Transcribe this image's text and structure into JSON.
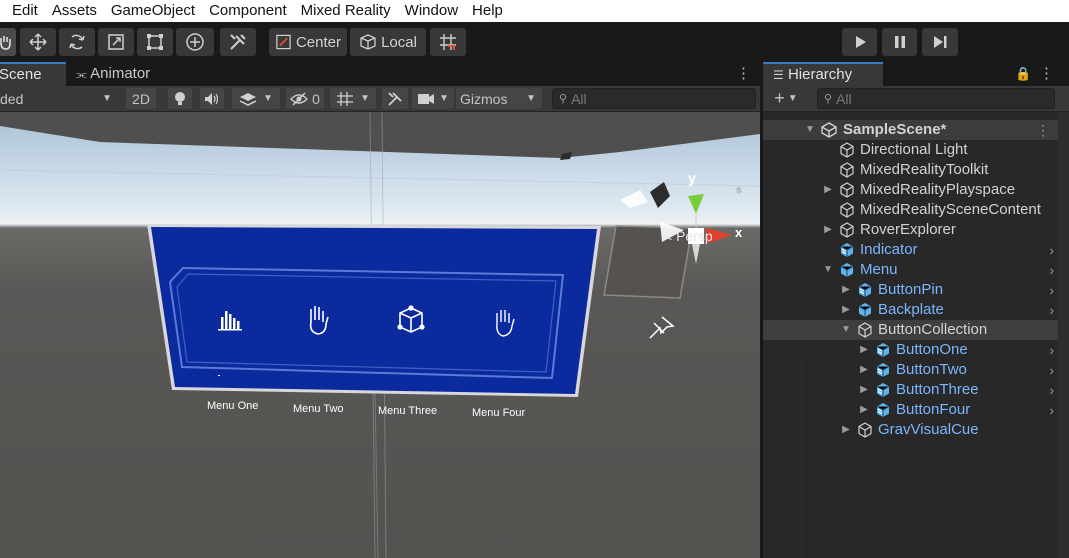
{
  "menu": [
    "Edit",
    "Assets",
    "GameObject",
    "Component",
    "Mixed Reality",
    "Window",
    "Help"
  ],
  "toolbar": {
    "pivot_label": "Center",
    "space_label": "Local",
    "play_icon": "play-icon",
    "pause_icon": "pause-icon",
    "step_icon": "step-icon"
  },
  "scene": {
    "tab_scene": "Scene",
    "tab_animator": "Animator",
    "shading_mode": "ded",
    "mode_2d": "2D",
    "hidden_count": "0",
    "gizmos_label": "Gizmos",
    "search_placeholder": "All",
    "persp_label": "< Persp",
    "gizmo_y": "y",
    "gizmo_x": "x"
  },
  "menu_panel": {
    "buttons": [
      "Menu One",
      "Menu Two",
      "Menu Three",
      "Menu Four"
    ],
    "background_color": "#0b2a9e",
    "frame_color": "#5a7bd6"
  },
  "hierarchy": {
    "tab_label": "Hierarchy",
    "search_placeholder": "All",
    "items": [
      {
        "label": "SampleScene*",
        "kind": "scene"
      },
      {
        "label": "Directional Light",
        "kind": "object"
      },
      {
        "label": "MixedRealityToolkit",
        "kind": "object"
      },
      {
        "label": "MixedRealityPlayspace",
        "kind": "object"
      },
      {
        "label": "MixedRealitySceneContent",
        "kind": "object"
      },
      {
        "label": "RoverExplorer",
        "kind": "object"
      },
      {
        "label": "Indicator",
        "kind": "prefab"
      },
      {
        "label": "Menu",
        "kind": "prefab"
      },
      {
        "label": "ButtonPin",
        "kind": "prefab"
      },
      {
        "label": "Backplate",
        "kind": "prefab"
      },
      {
        "label": "ButtonCollection",
        "kind": "object"
      },
      {
        "label": "ButtonOne",
        "kind": "prefab"
      },
      {
        "label": "ButtonTwo",
        "kind": "prefab"
      },
      {
        "label": "ButtonThree",
        "kind": "prefab"
      },
      {
        "label": "ButtonFour",
        "kind": "prefab"
      },
      {
        "label": "GravVisualCue",
        "kind": "prefab"
      }
    ]
  },
  "colors": {
    "prefab_text": "#7bb6ff",
    "accent": "#3a79bb"
  }
}
